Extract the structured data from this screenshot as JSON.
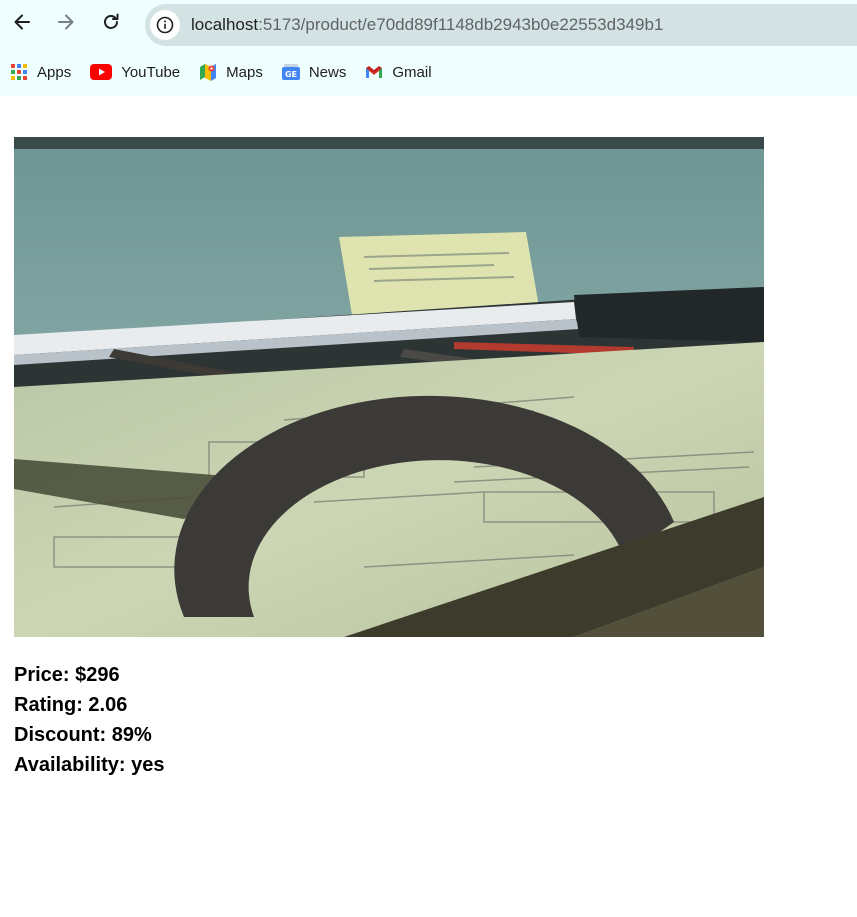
{
  "browser": {
    "url_host": "localhost",
    "url_path": ":5173/product/e70dd89f1148db2943b0e22553d349b1",
    "bookmarks": [
      {
        "label": "Apps",
        "icon": "apps-grid-icon"
      },
      {
        "label": "YouTube",
        "icon": "youtube-icon"
      },
      {
        "label": "Maps",
        "icon": "maps-icon"
      },
      {
        "label": "News",
        "icon": "news-icon"
      },
      {
        "label": "Gmail",
        "icon": "gmail-icon"
      }
    ]
  },
  "product": {
    "image_description": "architectural drafting tools on blueprint",
    "price_line": "Price: $296",
    "rating_line": "Rating: 2.06",
    "discount_line": "Discount: 89%",
    "availability_line": "Availability: yes"
  }
}
